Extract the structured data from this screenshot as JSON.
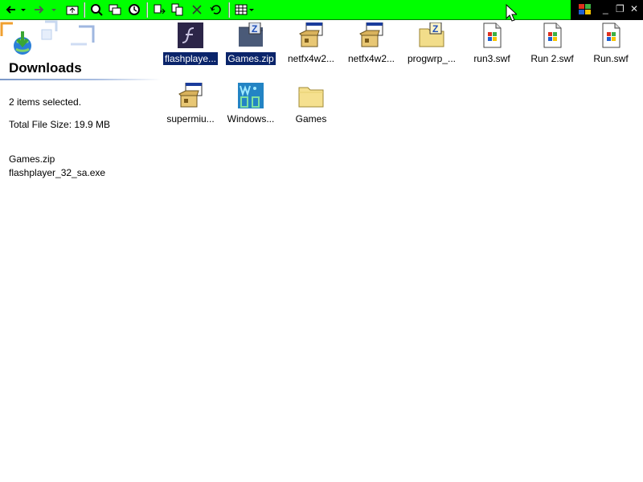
{
  "window": {
    "toolbar_color": "#00ff00",
    "selection_color": "#0a246a",
    "controls": {
      "minimize": "_",
      "restore": "❐",
      "close": "✕"
    }
  },
  "toolbar": {
    "buttons": [
      "back-icon",
      "dropdown-icon",
      "forward-icon",
      "dropdown-icon",
      "up-folder-icon",
      "search-icon",
      "folders-icon",
      "history-icon",
      "move-to-icon",
      "copy-to-icon",
      "delete-icon",
      "undo-icon",
      "views-icon",
      "dropdown-icon"
    ]
  },
  "sidebar": {
    "folder_title": "Downloads",
    "selection_count": "2 items selected.",
    "total_size": "Total File Size: 19.9 MB",
    "selected_files": [
      "Games.zip",
      "flashplayer_32_sa.exe"
    ]
  },
  "files": [
    {
      "label": "flashplaye...",
      "icon": "flash-app-icon",
      "selected": true
    },
    {
      "label": "Games.zip",
      "icon": "zip-file-icon",
      "selected": true
    },
    {
      "label": "netfx4w2...",
      "icon": "installer-icon",
      "selected": false
    },
    {
      "label": "netfx4w2...",
      "icon": "installer-icon",
      "selected": false
    },
    {
      "label": "progwrp_...",
      "icon": "zip-folder-icon",
      "selected": false
    },
    {
      "label": "run3.swf",
      "icon": "swf-file-icon",
      "selected": false
    },
    {
      "label": "Run 2.swf",
      "icon": "swf-file-icon",
      "selected": false
    },
    {
      "label": "Run.swf",
      "icon": "swf-file-icon",
      "selected": false
    },
    {
      "label": "supermiu...",
      "icon": "installer-icon",
      "selected": false
    },
    {
      "label": "Windows...",
      "icon": "windows-2000-icon",
      "selected": false
    },
    {
      "label": "Games",
      "icon": "folder-icon",
      "selected": false
    }
  ]
}
